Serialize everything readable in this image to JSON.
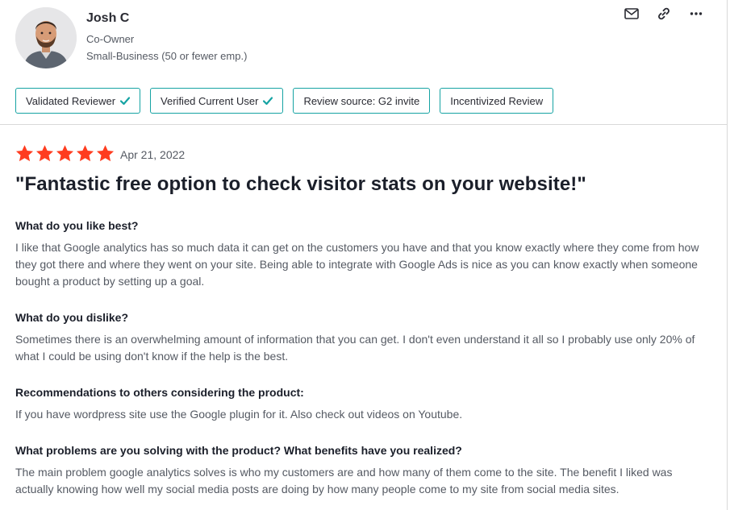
{
  "reviewer": {
    "name": "Josh C",
    "role": "Co-Owner",
    "segment": "Small-Business (50 or fewer emp.)"
  },
  "actions": [
    {
      "name": "email-icon"
    },
    {
      "name": "link-icon"
    },
    {
      "name": "more-icon"
    }
  ],
  "badges": [
    {
      "label": "Validated Reviewer",
      "check": true
    },
    {
      "label": "Verified Current User",
      "check": true
    },
    {
      "label": "Review source: G2 invite",
      "check": false
    },
    {
      "label": "Incentivized Review",
      "check": false
    }
  ],
  "rating": {
    "stars": 5,
    "max": 5,
    "color": "#ff3c1f"
  },
  "date": "Apr 21, 2022",
  "title": "\"Fantastic free option to check visitor stats on your website!\"",
  "sections": [
    {
      "question": "What do you like best?",
      "answer": "I like that Google analytics has so much data it can get on the customers you have and that you know exactly where they come from how they got there and where they went on your site. Being able to integrate with Google Ads is nice as you can know exactly when someone bought a product by setting up a goal."
    },
    {
      "question": "What do you dislike?",
      "answer": "Sometimes there is an overwhelming amount of information that you can get. I don't even understand it all so I probably use only 20% of what I could be using don't know if the help is the best."
    },
    {
      "question": "Recommendations to others considering the product:",
      "answer": "If you have wordpress site use the Google plugin for it. Also check out videos on Youtube."
    },
    {
      "question": "What problems are you solving with the product? What benefits have you realized?",
      "answer": "The main problem google analytics solves is who my customers are and how many of them come to the site. The benefit I liked was actually knowing how well my social media posts are doing by how many people come to my site from social media sites."
    }
  ],
  "colors": {
    "accent": "#15a3a3",
    "star": "#ff3c1f",
    "text": "#1b1f2a",
    "muted": "#555a63"
  }
}
